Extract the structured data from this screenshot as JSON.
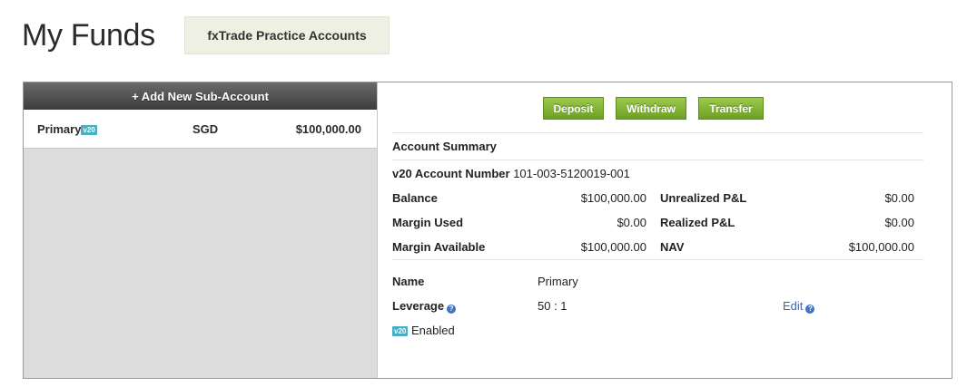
{
  "header": {
    "title": "My Funds",
    "practice_tab": "fxTrade Practice Accounts"
  },
  "sidebar": {
    "add_button": "+ Add New Sub-Account",
    "accounts": [
      {
        "name": "Primary",
        "badge": "v20",
        "currency": "SGD",
        "balance": "$100,000.00"
      }
    ]
  },
  "actions": {
    "deposit": "Deposit",
    "withdraw": "Withdraw",
    "transfer": "Transfer"
  },
  "summary": {
    "title": "Account Summary",
    "account_number_label": "v20 Account Number",
    "account_number": "101-003-5120019-001",
    "balance_label": "Balance",
    "balance": "$100,000.00",
    "unrealized_label": "Unrealized P&L",
    "unrealized": "$0.00",
    "margin_used_label": "Margin Used",
    "margin_used": "$0.00",
    "realized_label": "Realized P&L",
    "realized": "$0.00",
    "margin_available_label": "Margin Available",
    "margin_available": "$100,000.00",
    "nav_label": "NAV",
    "nav": "$100,000.00"
  },
  "details": {
    "name_label": "Name",
    "name": "Primary",
    "leverage_label": "Leverage",
    "leverage": "50 : 1",
    "edit_label": "Edit",
    "help_glyph": "?",
    "v20_badge": "v20",
    "enabled_label": "Enabled"
  },
  "icons": {
    "help": "help-icon"
  },
  "colors": {
    "button_green": "#7fb339",
    "badge_blue": "#4aaec2",
    "link_blue": "#2f6db8"
  }
}
